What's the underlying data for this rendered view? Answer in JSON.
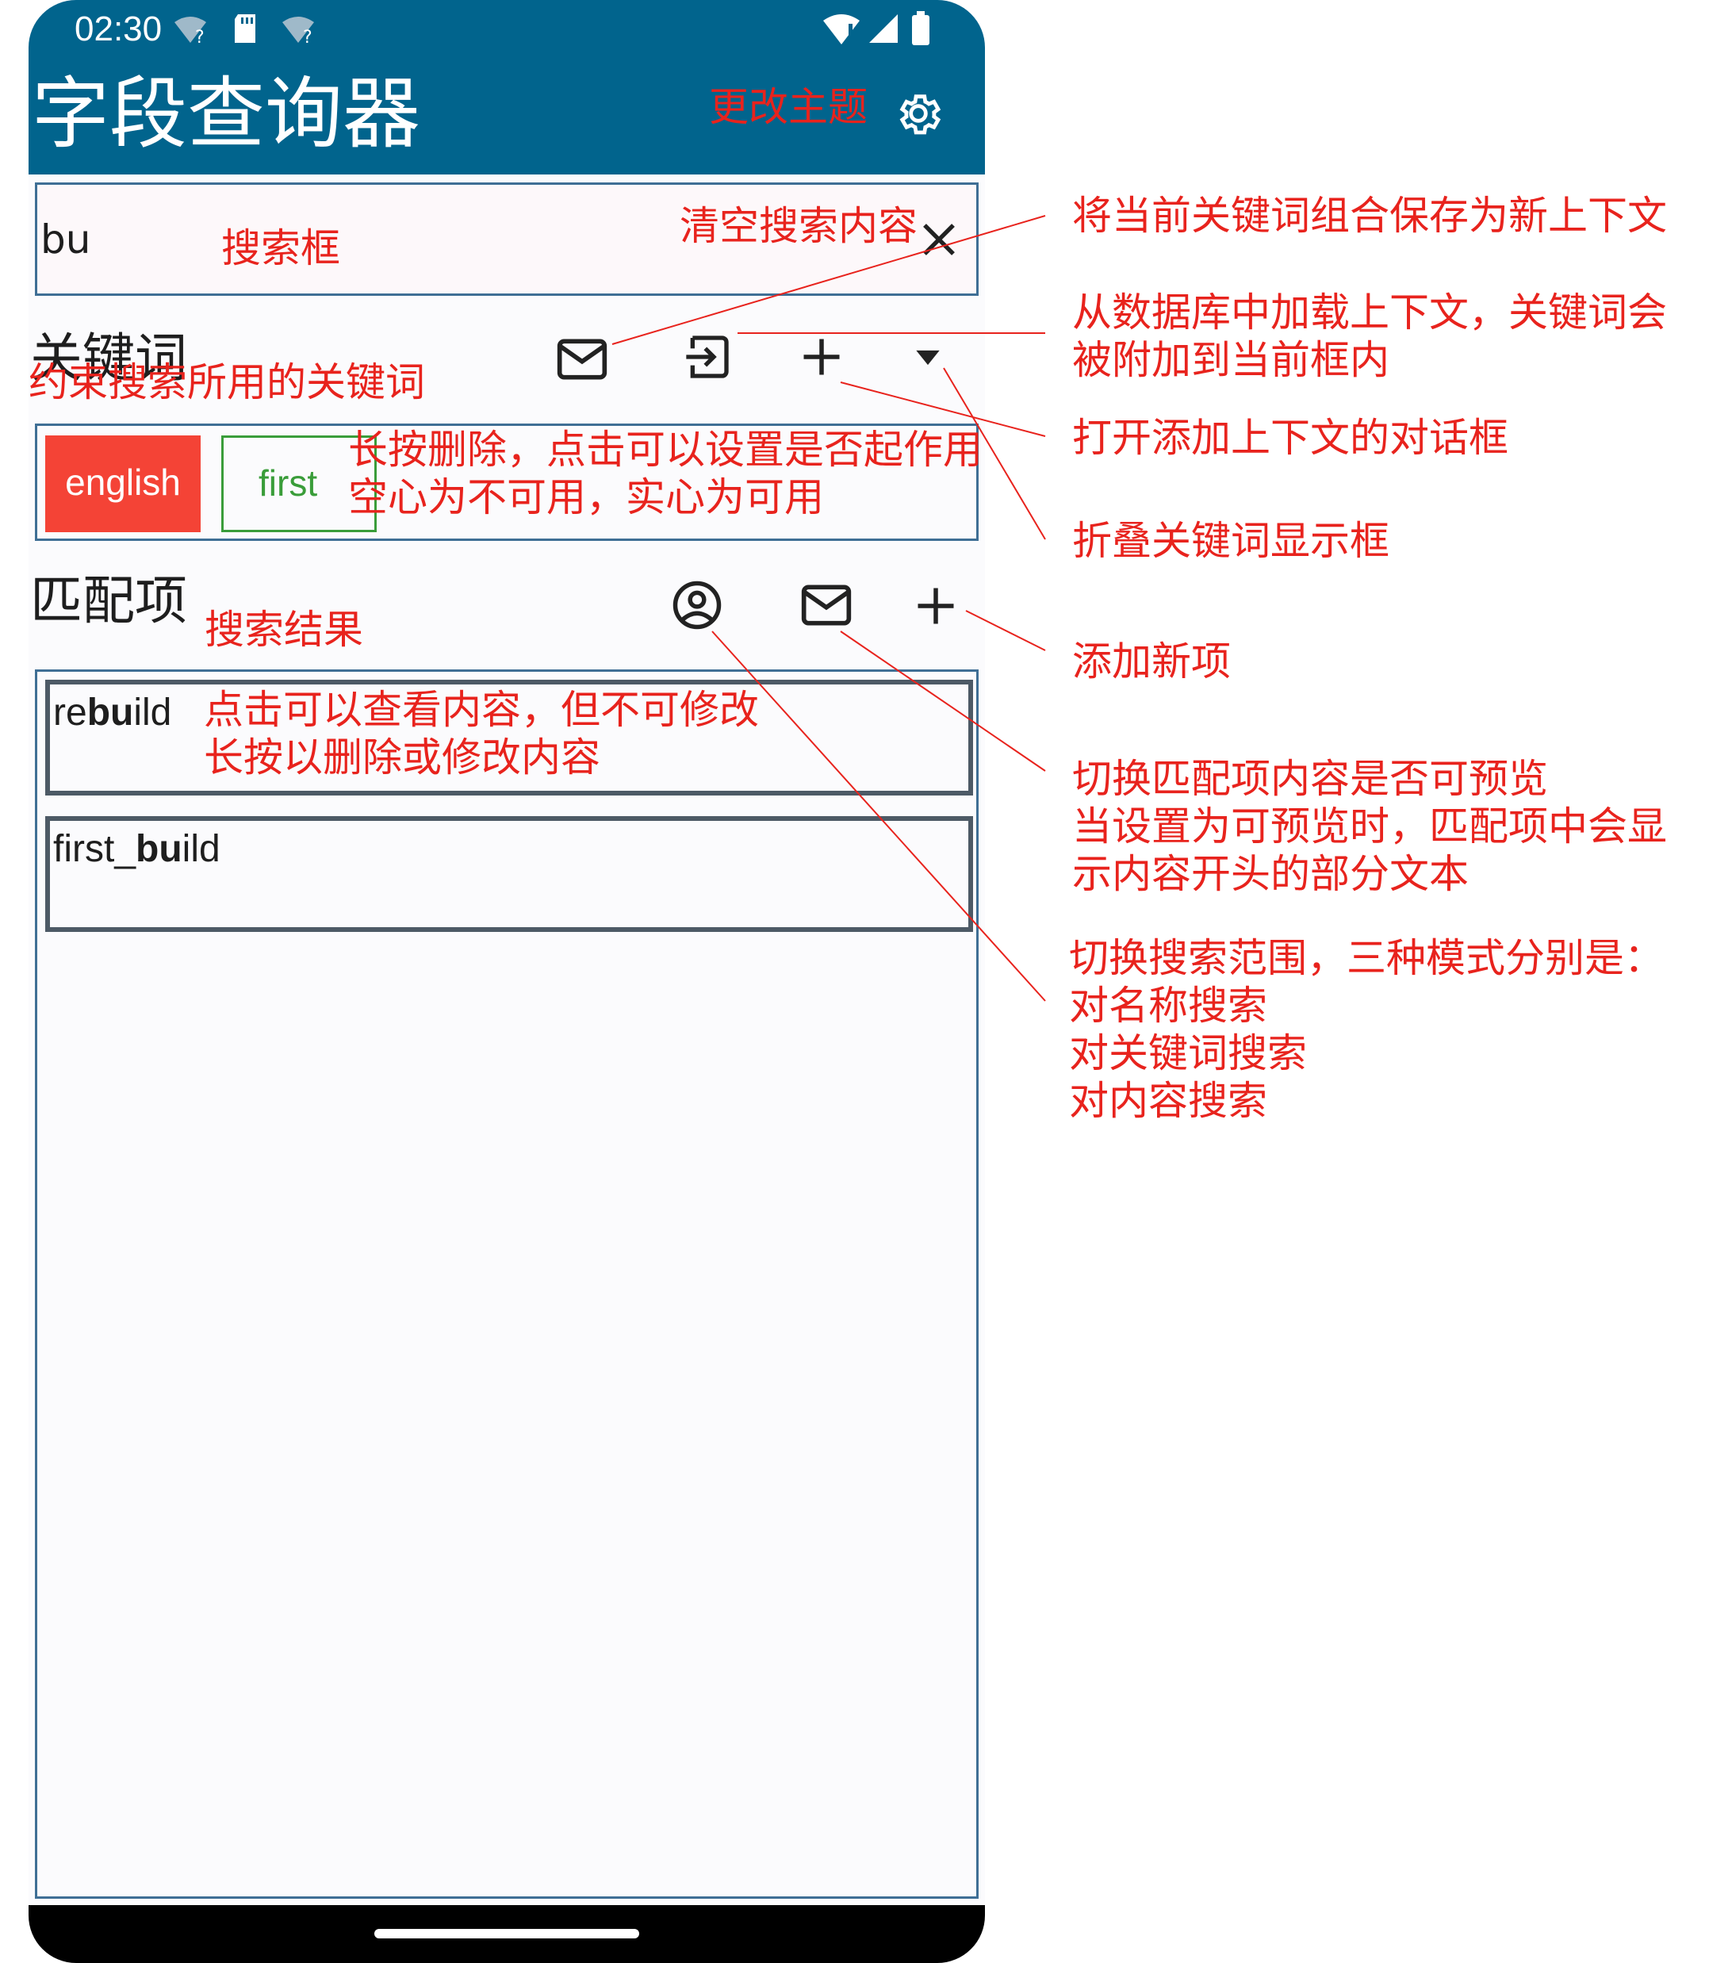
{
  "status_bar": {
    "time": "02:30"
  },
  "app_bar": {
    "title": "字段查询器",
    "change_theme_label": "更改主题",
    "settings_icon": "gear-icon"
  },
  "search": {
    "value": "bu",
    "annotation": "搜索框",
    "clear_annotation": "清空搜索内容",
    "clear_icon": "close-icon"
  },
  "keywords": {
    "heading": "关键词",
    "annotation": "约束搜索所用的关键词",
    "chips": [
      {
        "label": "english",
        "style": "filled",
        "color": "#f44336"
      },
      {
        "label": "first",
        "style": "outlined",
        "color": "#3a9d3a"
      }
    ],
    "chip_annotation_line1": "长按删除，点击可以设置是否起作用",
    "chip_annotation_line2": "空心为不可用，实心为可用",
    "icons": [
      "mail-icon",
      "import-icon",
      "plus-icon",
      "dropdown-arrow-icon"
    ]
  },
  "matches": {
    "heading": "匹配项",
    "annotation": "搜索结果",
    "icons": [
      "account-circle-icon",
      "mail-icon",
      "plus-icon"
    ],
    "items": [
      {
        "prefix": "re",
        "match": "bu",
        "suffix": "ild"
      },
      {
        "prefix": "first_",
        "match": "bu",
        "suffix": "ild"
      }
    ],
    "item_annotation_line1": "点击可以查看内容，但不可修改",
    "item_annotation_line2": "长按以删除或修改内容"
  },
  "side_annotations": {
    "save_context": "将当前关键词组合保存为新上下文",
    "load_context_line1": "从数据库中加载上下文，关键词会",
    "load_context_line2": "被附加到当前框内",
    "open_add_dialog": "打开添加上下文的对话框",
    "collapse_keywords": "折叠关键词显示框",
    "add_new_item": "添加新项",
    "preview_line1": "切换匹配项内容是否可预览",
    "preview_line2": "当设置为可预览时，匹配项中会显",
    "preview_line3": "示内容开头的部分文本",
    "scope_line1": "切换搜索范围，三种模式分别是：",
    "scope_line2": "对名称搜索",
    "scope_line3": "对关键词搜索",
    "scope_line4": "对内容搜索"
  },
  "colors": {
    "app_bar": "#01648d",
    "annotation": "#e8231d",
    "box_border": "#3f6f95"
  }
}
